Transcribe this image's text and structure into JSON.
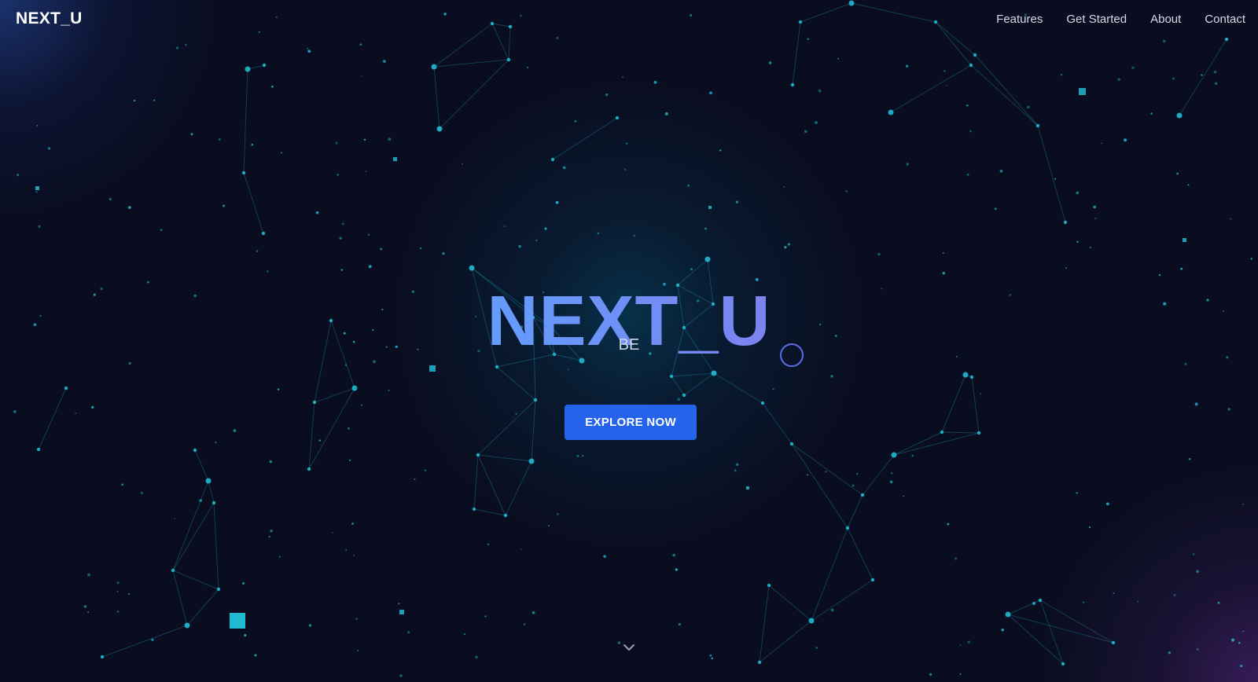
{
  "header": {
    "brand": "NEXT_U",
    "nav": [
      {
        "label": "Features"
      },
      {
        "label": "Get Started"
      },
      {
        "label": "About"
      },
      {
        "label": "Contact"
      }
    ]
  },
  "hero": {
    "title": "NEXT_U",
    "subtitle": "BE",
    "cta_label": "EXPLORE NOW"
  },
  "icons": {
    "scroll": "chevron-down-icon"
  },
  "colors": {
    "background": "#0a0d1f",
    "particle": "#22c3dc",
    "accent_button": "#2563eb",
    "title_gradient_start": "#5fa0ff",
    "title_gradient_end": "#8a7ff0"
  }
}
